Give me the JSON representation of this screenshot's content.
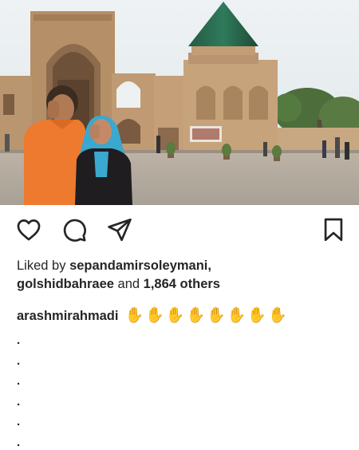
{
  "post": {
    "image_description_icon": "photo",
    "liked_prefix": "Liked by",
    "liker_1": "sepandamirsoleymani,",
    "liker_2": "golshidbahraee",
    "and_text": "and",
    "others_count": "1,864 others",
    "caption_user": "arashmirahmadi",
    "caption_emojis": "✋✋✋✋✋✋✋✋",
    "caption_dots": [
      ".",
      ".",
      ".",
      ".",
      ".",
      "."
    ]
  },
  "actions": {
    "like_icon": "heart-icon",
    "comment_icon": "comment-icon",
    "share_icon": "send-icon",
    "save_icon": "bookmark-icon"
  }
}
